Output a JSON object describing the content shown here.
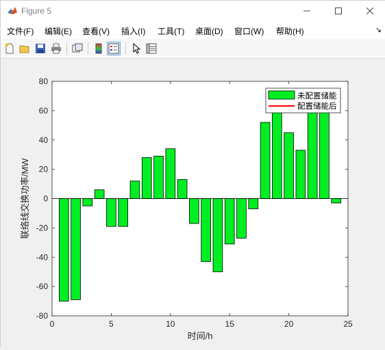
{
  "window": {
    "title": "Figure 5"
  },
  "menu": [
    {
      "label": "文件(F)"
    },
    {
      "label": "编辑(E)"
    },
    {
      "label": "查看(V)"
    },
    {
      "label": "插入(I)"
    },
    {
      "label": "工具(T)"
    },
    {
      "label": "桌面(D)"
    },
    {
      "label": "窗口(W)"
    },
    {
      "label": "帮助(H)"
    }
  ],
  "menu_overflow": "↘",
  "toolbar_icons": [
    "new-figure-icon",
    "open-file-icon",
    "save-icon",
    "print-icon",
    "copy-figure-icon",
    "colorbar-icon",
    "legend-icon",
    "pointer-icon",
    "property-inspector-icon"
  ],
  "colors": {
    "bar": "#00ee22",
    "line_legend": "#ff0000",
    "axes_bg": "#ffffff"
  },
  "chart_data": {
    "type": "bar",
    "x": [
      1,
      2,
      3,
      4,
      5,
      6,
      7,
      8,
      9,
      10,
      11,
      12,
      13,
      14,
      15,
      16,
      17,
      18,
      19,
      20,
      21,
      22,
      23,
      24
    ],
    "series": [
      {
        "name": "未配置储能",
        "values": [
          -70,
          -69,
          -5,
          6,
          -19,
          -19,
          12,
          28,
          29,
          34,
          13,
          -17,
          -43,
          -50,
          -31,
          -27,
          -7,
          52,
          62,
          45,
          33,
          72,
          72,
          -3
        ]
      },
      {
        "name": "配置储能后",
        "values": []
      }
    ],
    "xlabel": "时间/h",
    "ylabel": "联络线交换功率/MW",
    "xlim": [
      0,
      25
    ],
    "ylim": [
      -80,
      80
    ],
    "xticks": [
      0,
      5,
      10,
      15,
      20,
      25
    ],
    "yticks": [
      -80,
      -60,
      -40,
      -20,
      0,
      20,
      40,
      60,
      80
    ],
    "legend_position": "top-right",
    "grid": false
  }
}
